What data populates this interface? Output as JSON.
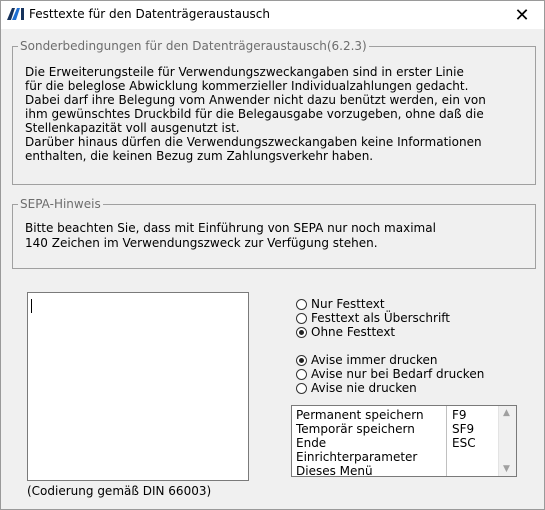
{
  "window": {
    "title": "Festtexte für den Datenträgeraustausch",
    "close_glyph": "✕"
  },
  "group1": {
    "legend": "Sonderbedingungen für den Datenträgeraustausch(6.2.3)",
    "lines": [
      "Die Erweiterungsteile für Verwendungszweckangaben sind in erster Linie",
      "für die beleglose Abwicklung kommerzieller Individualzahlungen gedacht.",
      "Dabei darf ihre Belegung vom Anwender nicht dazu benützt werden, ein von",
      "ihm gewünschtes Druckbild für die Belegausgabe vorzugeben, ohne daß die",
      "Stellenkapazität voll ausgenutzt ist.",
      "Darüber hinaus dürfen die Verwendungszweckangaben keine Informationen",
      "enthalten, die keinen Bezug zum Zahlungsverkehr haben."
    ]
  },
  "group2": {
    "legend": "SEPA-Hinweis",
    "lines": [
      "Bitte beachten Sie, dass mit Einführung von SEPA nur noch maximal",
      "140 Zeichen im Verwendungszweck zur Verfügung stehen."
    ]
  },
  "textarea": {
    "value": ""
  },
  "caption": "(Codierung gemäß DIN 66003)",
  "radio_group1": {
    "options": [
      "Nur Festtext",
      "Festtext als Überschrift",
      "Ohne Festtext"
    ],
    "selected": 2
  },
  "radio_group2": {
    "options": [
      "Avise immer drucken",
      "Avise nur bei Bedarf drucken",
      "Avise nie drucken"
    ],
    "selected": 0
  },
  "listbox": {
    "items": [
      {
        "label": "Permanent speichern",
        "key": "F9"
      },
      {
        "label": "Temporär speichern",
        "key": "SF9"
      },
      {
        "label": "Ende",
        "key": "ESC"
      },
      {
        "label": "Einrichterparameter",
        "key": ""
      },
      {
        "label": "Dieses Menü",
        "key": ""
      }
    ],
    "scroll_up_glyph": "▲",
    "scroll_down_glyph": "▼"
  },
  "colors": {
    "app_icon_blue": "#1f6fd1",
    "app_icon_dark": "#16325c"
  }
}
